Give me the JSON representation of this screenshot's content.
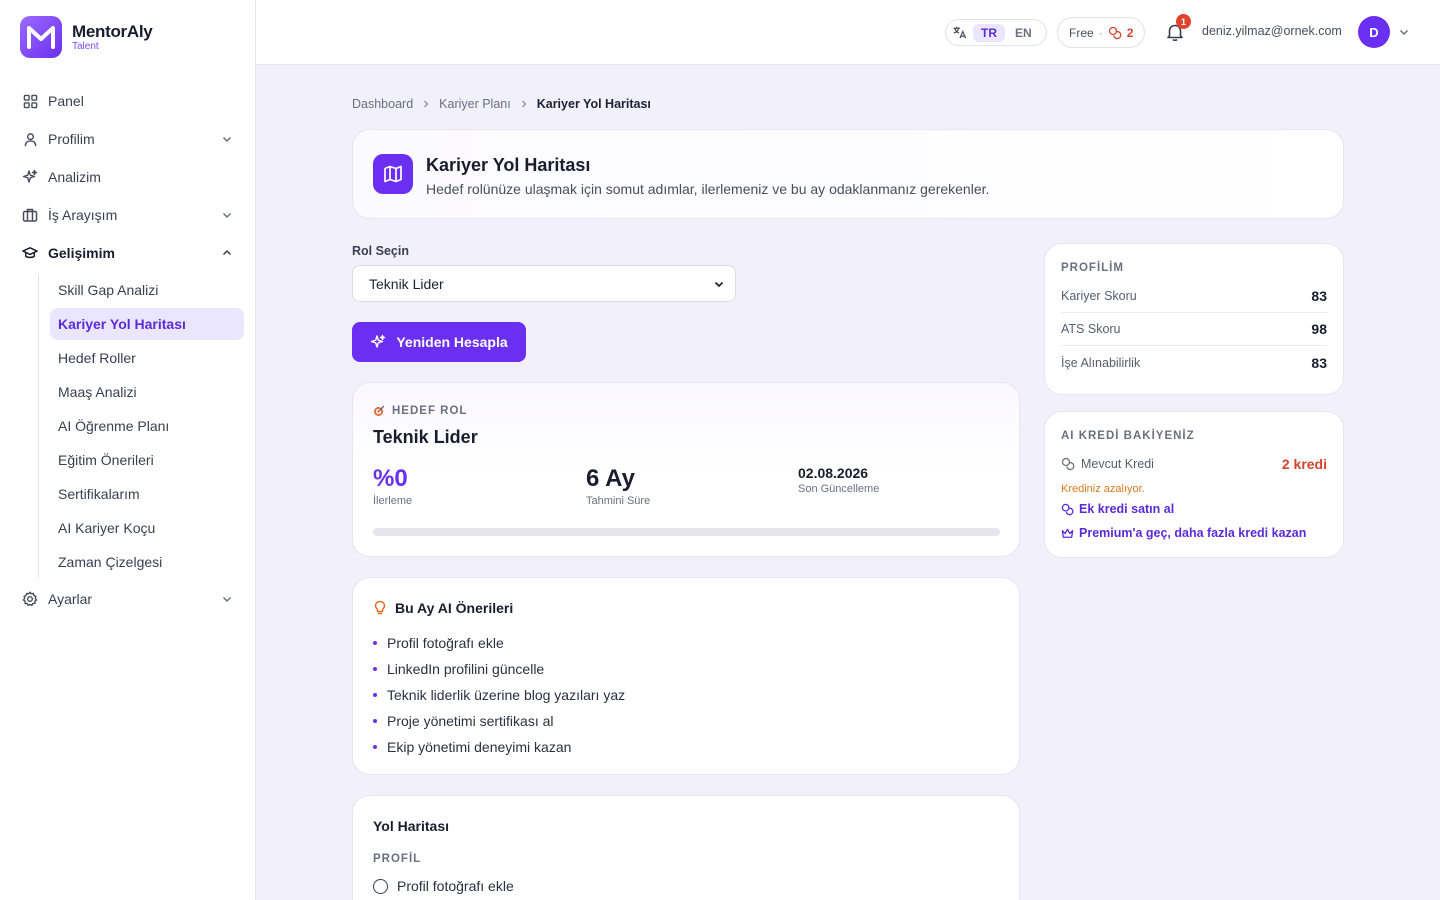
{
  "brand": {
    "name": "MentorAly",
    "sub": "Talent"
  },
  "sidebar": {
    "items": [
      {
        "label": "Panel",
        "icon": "grid-icon"
      },
      {
        "label": "Profilim",
        "icon": "user-icon"
      },
      {
        "label": "Analizim",
        "icon": "sparkle-icon"
      },
      {
        "label": "İş Arayışım",
        "icon": "briefcase-icon"
      },
      {
        "label": "Gelişimim",
        "icon": "graduation-cap-icon"
      },
      {
        "label": "Ayarlar",
        "icon": "gear-icon"
      }
    ],
    "sub_items": [
      "Skill Gap Analizi",
      "Kariyer Yol Haritası",
      "Hedef Roller",
      "Maaş Analizi",
      "AI Öğrenme Planı",
      "Eğitim Önerileri",
      "Sertifikalarım",
      "AI Kariyer Koçu",
      "Zaman Çizelgesi"
    ]
  },
  "topbar": {
    "lang_tr": "TR",
    "lang_en": "EN",
    "plan": "Free",
    "plan_sep": "·",
    "plan_credits": "2",
    "notifications": "1",
    "email": "deniz.yilmaz@ornek.com",
    "avatar": "D"
  },
  "breadcrumb": [
    "Dashboard",
    "Kariyer Planı",
    "Kariyer Yol Haritası"
  ],
  "header": {
    "title": "Kariyer Yol Haritası",
    "description": "Hedef rolünüze ulaşmak için somut adımlar, ilerlemeniz ve bu ay odaklanmanız gerekenler."
  },
  "role": {
    "label": "Rol Seçin",
    "selected": "Teknik Lider",
    "recalc_label": "Yeniden Hesapla"
  },
  "target": {
    "label": "HEDEF ROL",
    "role": "Teknik Lider",
    "progress_value": "%0",
    "progress_label": "İlerleme",
    "progress_percent": 0,
    "duration_value": "6 Ay",
    "duration_label": "Tahmini Süre",
    "updated_value": "02.08.2026",
    "updated_label": "Son Güncelleme"
  },
  "ai": {
    "title": "Bu Ay AI Önerileri",
    "items": [
      "Profil fotoğrafı ekle",
      "LinkedIn profilini güncelle",
      "Teknik liderlik üzerine blog yazıları yaz",
      "Proje yönetimi sertifikası al",
      "Ekip yönetimi deneyimi kazan"
    ]
  },
  "roadmap": {
    "title": "Yol Haritası",
    "section": "PROFİL",
    "first_item": "Profil fotoğrafı ekle"
  },
  "profile": {
    "title": "PROFİLİM",
    "rows": [
      {
        "label": "Kariyer Skoru",
        "value": "83"
      },
      {
        "label": "ATS Skoru",
        "value": "98"
      },
      {
        "label": "İşe Alınabilirlik",
        "value": "83"
      }
    ]
  },
  "credits": {
    "title": "AI KREDİ BAKİYENİZ",
    "label": "Mevcut Kredi",
    "amount": "2 kredi",
    "warning": "Krediniz azalıyor.",
    "buy_link": "Ek kredi satın al",
    "premium_link": "Premium'a geç, daha fazla kredi kazan"
  },
  "colors": {
    "accent": "#6a2ff0",
    "warning": "#d4442f",
    "background": "#f1f0fb"
  }
}
